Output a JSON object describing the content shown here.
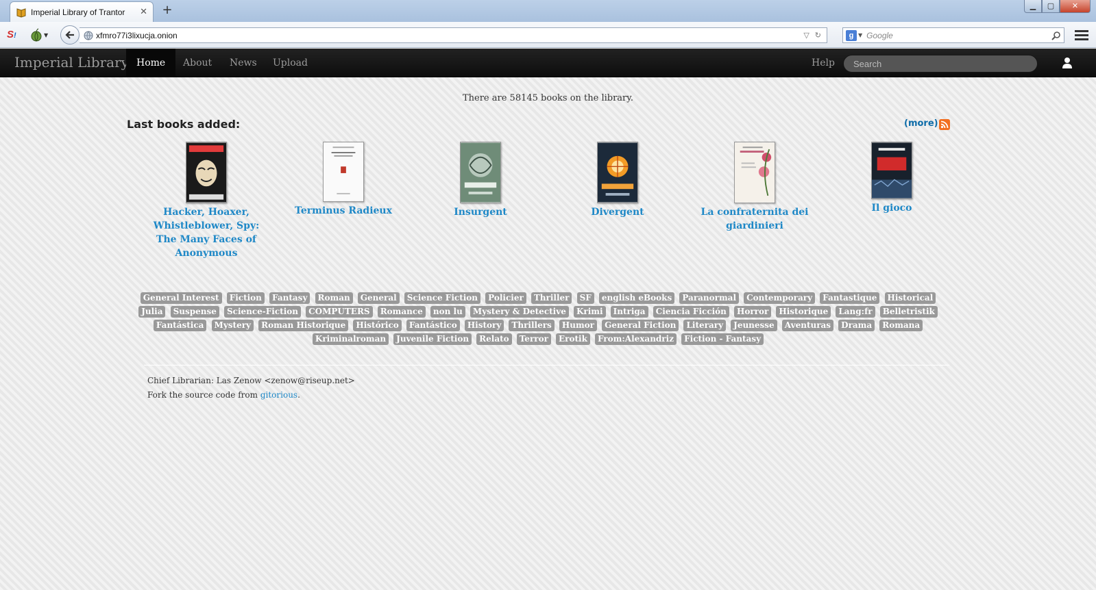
{
  "browser": {
    "tab_title": "Imperial Library of Trantor",
    "url": "xfmro77i3lixucja.onion",
    "search_placeholder": "Google"
  },
  "site_nav": {
    "brand": "Imperial Library",
    "links": [
      "Home",
      "About",
      "News",
      "Upload"
    ],
    "active": "Home",
    "help": "Help",
    "search_placeholder": "Search"
  },
  "main": {
    "book_count_text": "There are 58145 books on the library.",
    "last_books_heading": "Last books added:",
    "more_label": "more",
    "books": [
      {
        "title": "Hacker, Hoaxer, Whistleblower, Spy: The Many Faces of Anonymous"
      },
      {
        "title": "Terminus Radieux"
      },
      {
        "title": "Insurgent"
      },
      {
        "title": "Divergent"
      },
      {
        "title": "La confraternita dei giardinieri"
      },
      {
        "title": "Il gioco"
      }
    ],
    "tags": [
      "General Interest",
      "Fiction",
      "Fantasy",
      "Roman",
      "General",
      "Science Fiction",
      "Policier",
      "Thriller",
      "SF",
      "english eBooks",
      "Paranormal",
      "Contemporary",
      "Fantastique",
      "Historical",
      "Julia",
      "Suspense",
      "Science-Fiction",
      "COMPUTERS",
      "Romance",
      "non lu",
      "Mystery & Detective",
      "Krimi",
      "Intriga",
      "Ciencia Ficción",
      "Horror",
      "Historique",
      "Lang:fr",
      "Belletristik",
      "Fantástica",
      "Mystery",
      "Roman Historique",
      "Histórico",
      "Fantástico",
      "History",
      "Thrillers",
      "Humor",
      "General Fiction",
      "Literary",
      "Jeunesse",
      "Aventuras",
      "Drama",
      "Romana",
      "Kriminalroman",
      "Juvenile Fiction",
      "Relato",
      "Terror",
      "Erotik",
      "From:Alexandriz",
      "Fiction - Fantasy"
    ]
  },
  "footer": {
    "librarian": "Chief Librarian: Las Zenow <zenow@riseup.net>",
    "fork_prefix": "Fork the source code from",
    "fork_link": "gitorious",
    "fork_suffix": "."
  },
  "colors": {
    "link": "#1e88c7",
    "navbar": "#1b1b1b",
    "tag_bg": "#999999"
  }
}
